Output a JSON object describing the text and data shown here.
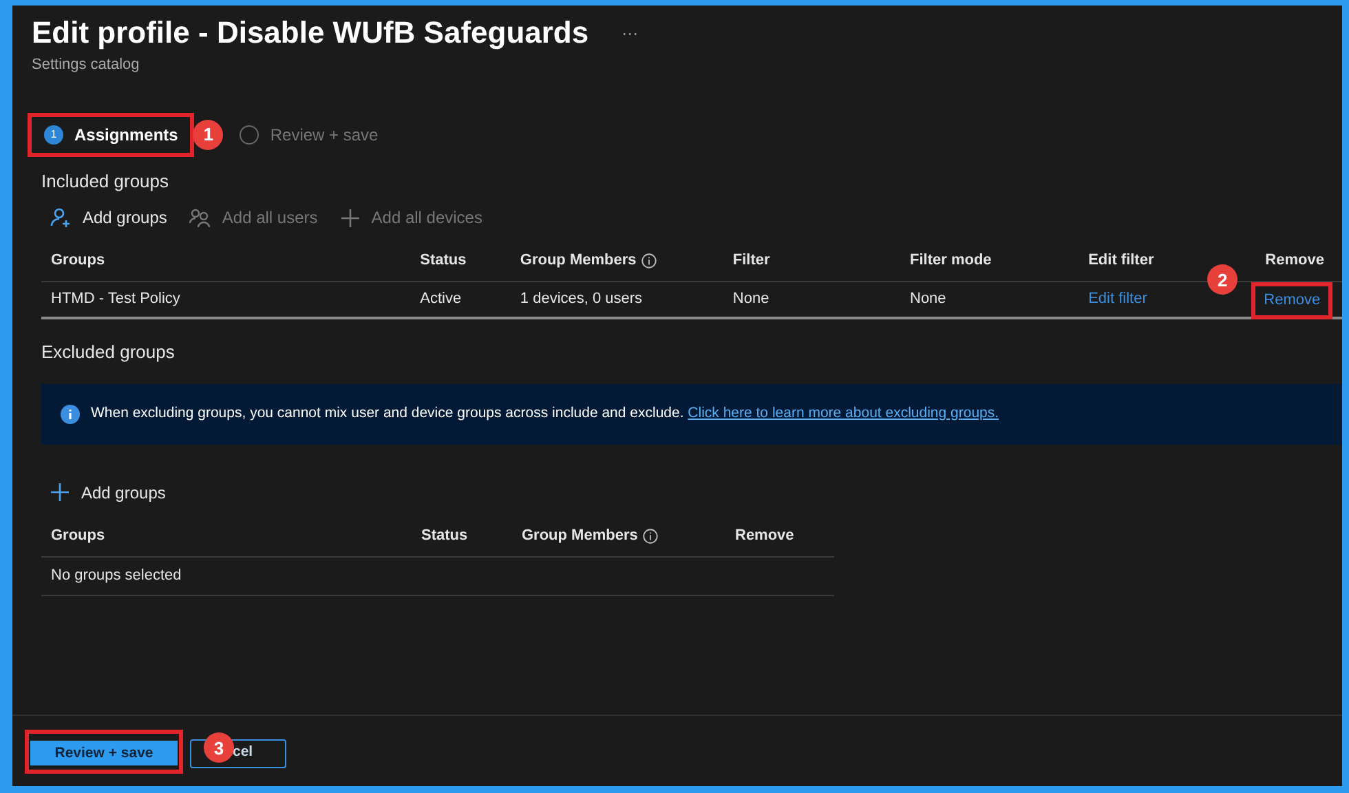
{
  "header": {
    "title": "Edit profile - Disable WUfB Safeguards",
    "more": "···",
    "subtitle": "Settings catalog"
  },
  "steps": [
    {
      "number": "1",
      "label": "Assignments",
      "selected": true,
      "callout": "1"
    },
    {
      "label": "Review + save",
      "selected": false
    }
  ],
  "included": {
    "title": "Included groups",
    "toolbar": [
      {
        "kind": "person",
        "label": "Add groups",
        "disabled": false
      },
      {
        "kind": "people",
        "label": "Add all users",
        "disabled": true
      },
      {
        "kind": "plus",
        "label": "Add all devices",
        "disabled": true
      }
    ],
    "columns": [
      {
        "label": "Groups"
      },
      {
        "label": "Status"
      },
      {
        "label": "Group Members",
        "info": true
      },
      {
        "label": "Filter"
      },
      {
        "label": "Filter mode"
      },
      {
        "label": "Edit filter"
      },
      {
        "label": "Remove"
      }
    ],
    "rows": [
      {
        "cells": [
          "HTMD - Test Policy",
          "Active",
          "1 devices, 0 users",
          "None",
          "None"
        ],
        "edit_filter": "Edit filter",
        "remove": "Remove",
        "callout": "2"
      }
    ]
  },
  "excluded": {
    "title": "Excluded groups",
    "info": {
      "text": "When excluding groups, you cannot mix user and device groups across include and exclude.",
      "link": "Click here to learn more about excluding groups."
    },
    "toolbar": [
      {
        "kind": "plus",
        "label": "Add groups",
        "disabled": false
      }
    ],
    "columns": [
      {
        "label": "Groups"
      },
      {
        "label": "Status"
      },
      {
        "label": "Group Members",
        "info": true
      },
      {
        "label": "Remove"
      }
    ],
    "empty": "No groups selected"
  },
  "footer": {
    "primary": "Review + save",
    "primary_callout": "3",
    "secondary": "cel"
  }
}
